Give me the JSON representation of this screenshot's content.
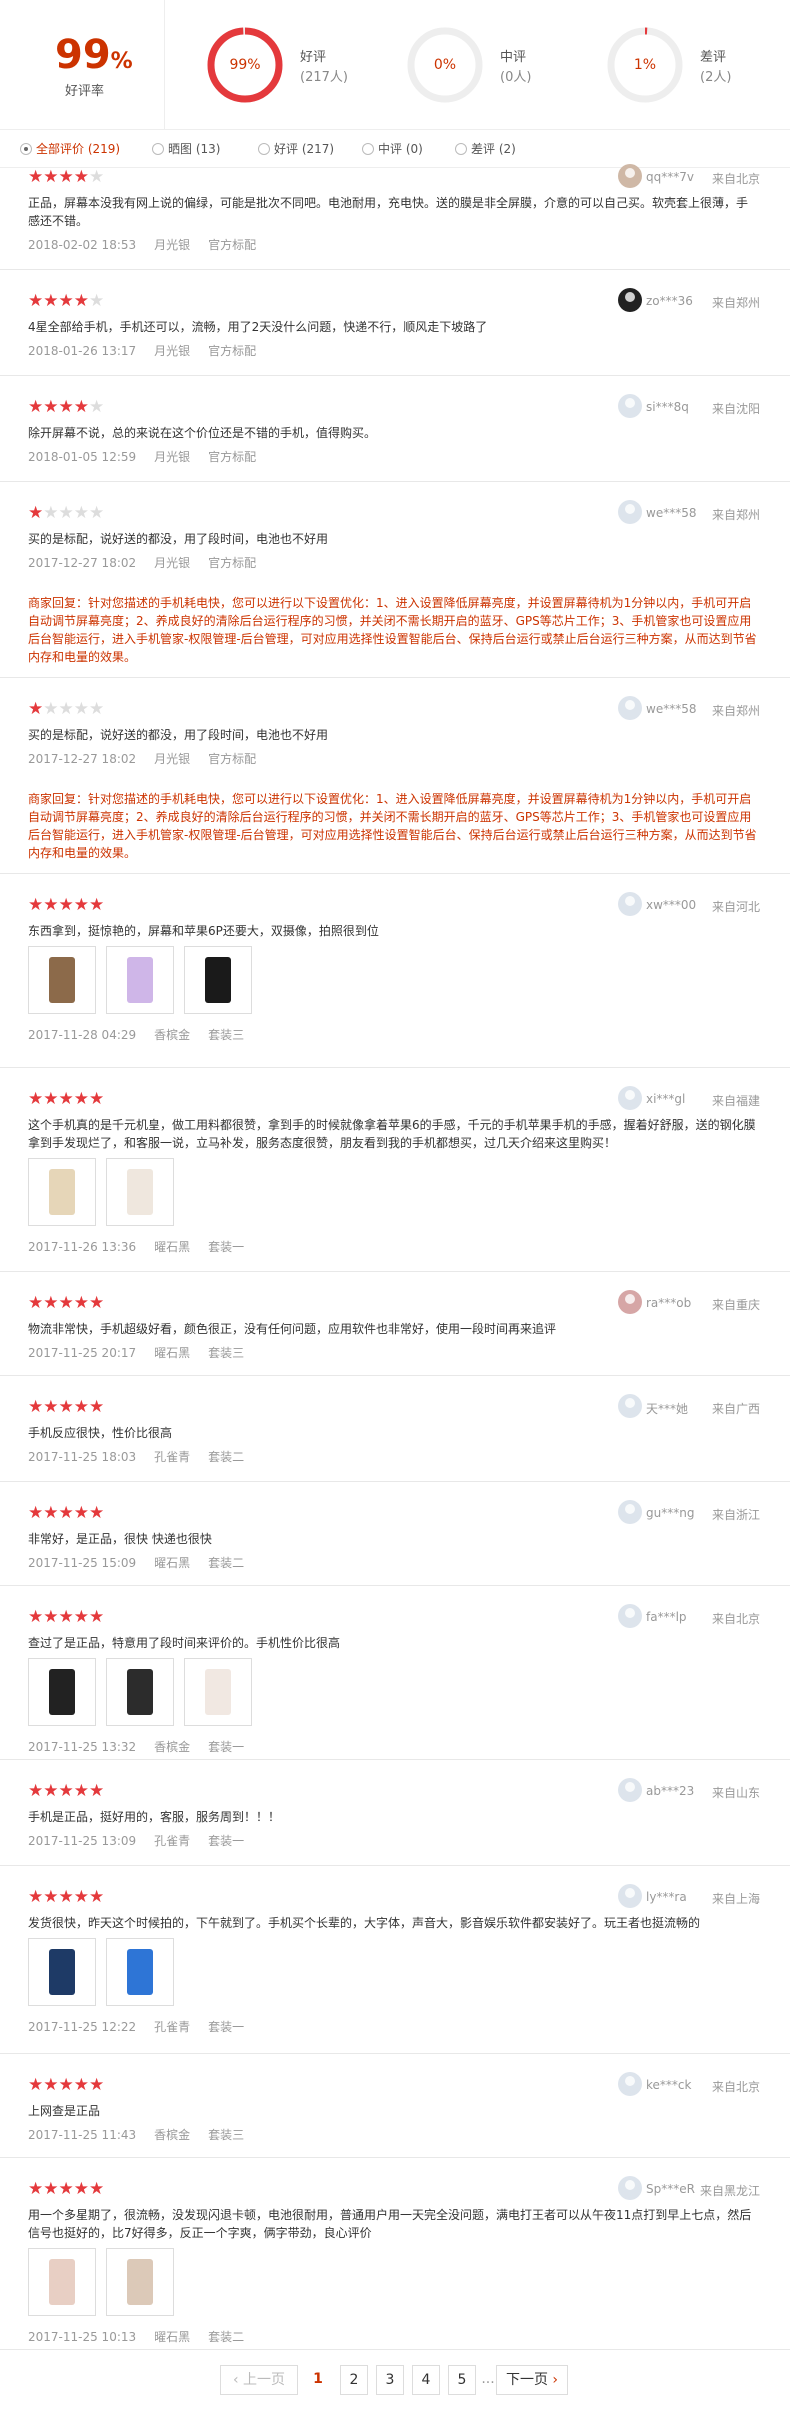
{
  "summary": {
    "rate_value": "99",
    "rate_pct": "%",
    "rate_label": "好评率",
    "good": {
      "pct": "99%",
      "label": "好评",
      "count": "(217人)",
      "fraction": 0.99
    },
    "mid": {
      "pct": "0%",
      "label": "中评",
      "count": "(0人)",
      "fraction": 0.0
    },
    "bad": {
      "pct": "1%",
      "label": "差评",
      "count": "(2人)",
      "fraction": 0.01
    }
  },
  "colors": {
    "accent": "#e4393c",
    "ring_track": "#eeeeee"
  },
  "filters": [
    "全部评价 (219)",
    "晒图 (13)",
    "好评 (217)",
    "中评 (0)",
    "差评 (2)"
  ],
  "reviews": [
    {
      "stars": 4,
      "user": "qq***7v",
      "loc": "来自北京",
      "avatar": "a1",
      "text": "正品，屏幕本没我有网上说的偏绿，可能是批次不同吧。电池耐用，充电快。送的膜是非全屏膜，介意的可以自己买。软壳套上很薄，手感还不错。",
      "date": "2018-02-02 18:53",
      "color": "月光银",
      "pkg": "官方标配"
    },
    {
      "stars": 4,
      "user": "zo***36",
      "loc": "来自郑州",
      "avatar": "a2",
      "text": "4星全部给手机，手机还可以，流畅，用了2天没什么问题，快递不行，顺风走下坡路了",
      "date": "2018-01-26 13:17",
      "color": "月光银",
      "pkg": "官方标配"
    },
    {
      "stars": 4,
      "user": "si***8q",
      "loc": "来自沈阳",
      "avatar": "a0",
      "text": "除开屏幕不说，总的来说在这个价位还是不错的手机，值得购买。",
      "date": "2018-01-05 12:59",
      "color": "月光银",
      "pkg": "官方标配"
    },
    {
      "stars": 1,
      "user": "we***58",
      "loc": "来自郑州",
      "avatar": "a0",
      "text": "买的是标配，说好送的都没，用了段时间，电池也不好用",
      "date": "2017-12-27 18:02",
      "color": "月光银",
      "pkg": "官方标配",
      "reply": "商家回复：针对您描述的手机耗电快，您可以进行以下设置优化：1、进入设置降低屏幕亮度，并设置屏幕待机为1分钟以内，手机可开启自动调节屏幕亮度；2、养成良好的清除后台运行程序的习惯，并关闭不需长期开启的蓝牙、GPS等芯片工作；3、手机管家也可设置应用后台智能运行，进入手机管家-权限管理-后台管理，可对应用选择性设置智能后台、保持后台运行或禁止后台运行三种方案，从而达到节省内存和电量的效果。"
    },
    {
      "stars": 1,
      "user": "we***58",
      "loc": "来自郑州",
      "avatar": "a0",
      "text": "买的是标配，说好送的都没，用了段时间，电池也不好用",
      "date": "2017-12-27 18:02",
      "color": "月光银",
      "pkg": "官方标配",
      "reply": "商家回复：针对您描述的手机耗电快，您可以进行以下设置优化：1、进入设置降低屏幕亮度，并设置屏幕待机为1分钟以内，手机可开启自动调节屏幕亮度；2、养成良好的清除后台运行程序的习惯，并关闭不需长期开启的蓝牙、GPS等芯片工作；3、手机管家也可设置应用后台智能运行，进入手机管家-权限管理-后台管理，可对应用选择性设置智能后台、保持后台运行或禁止后台运行三种方案，从而达到节省内存和电量的效果。"
    },
    {
      "stars": 5,
      "user": "xw***00",
      "loc": "来自河北",
      "avatar": "a0",
      "text": "东西拿到，挺惊艳的，屏幕和苹果6P还要大，双摄像，拍照很到位",
      "date": "2017-11-28 04:29",
      "color": "香槟金",
      "pkg": "套装三",
      "images": 3
    },
    {
      "stars": 5,
      "user": "xi***gl",
      "loc": "来自福建",
      "avatar": "a0",
      "text": "这个手机真的是千元机皇，做工用料都很赞，拿到手的时候就像拿着苹果6的手感，千元的手机苹果手机的手感，握着好舒服，送的钢化膜拿到手发现烂了，和客服一说，立马补发，服务态度很赞，朋友看到我的手机都想买，过几天介绍来这里购买！",
      "date": "2017-11-26 13:36",
      "color": "曜石黑",
      "pkg": "套装一",
      "images": 2
    },
    {
      "stars": 5,
      "user": "ra***ob",
      "loc": "来自重庆",
      "avatar": "a3",
      "text": "物流非常快，手机超级好看，颜色很正，没有任何问题，应用软件也非常好，使用一段时间再来追评",
      "date": "2017-11-25 20:17",
      "color": "曜石黑",
      "pkg": "套装三"
    },
    {
      "stars": 5,
      "user": "天***她",
      "loc": "来自广西",
      "avatar": "a0",
      "text": "手机反应很快，性价比很高",
      "date": "2017-11-25 18:03",
      "color": "孔雀青",
      "pkg": "套装二"
    },
    {
      "stars": 5,
      "user": "gu***ng",
      "loc": "来自浙江",
      "avatar": "a0",
      "text": "非常好，是正品，很快 快递也很快",
      "date": "2017-11-25 15:09",
      "color": "曜石黑",
      "pkg": "套装二"
    },
    {
      "stars": 5,
      "user": "fa***lp",
      "loc": "来自北京",
      "avatar": "a0",
      "text": "查过了是正品，特意用了段时间来评价的。手机性价比很高",
      "date": "2017-11-25 13:32",
      "color": "香槟金",
      "pkg": "套装一",
      "images": 3
    },
    {
      "stars": 5,
      "user": "ab***23",
      "loc": "来自山东",
      "avatar": "a0",
      "text": "手机是正品，挺好用的，客服，服务周到！！！",
      "date": "2017-11-25 13:09",
      "color": "孔雀青",
      "pkg": "套装一"
    },
    {
      "stars": 5,
      "user": "ly***ra",
      "loc": "来自上海",
      "avatar": "a0",
      "text": "发货很快，昨天这个时候拍的，下午就到了。手机买个长辈的，大字体，声音大，影音娱乐软件都安装好了。玩王者也挺流畅的",
      "date": "2017-11-25 12:22",
      "color": "孔雀青",
      "pkg": "套装一",
      "images": 2
    },
    {
      "stars": 5,
      "user": "ke***ck",
      "loc": "来自北京",
      "avatar": "a0",
      "text": "上网查是正品",
      "date": "2017-11-25 11:43",
      "color": "香槟金",
      "pkg": "套装三"
    },
    {
      "stars": 5,
      "user": "Sp***eR",
      "loc": "来自黑龙江",
      "avatar": "a0",
      "text": "用一个多星期了，很流畅，没发现闪退卡顿，电池很耐用，普通用户用一天完全没问题，满电打王者可以从午夜11点打到早上七点，然后信号也挺好的，比7好得多，反正一个字爽，俩字带劲，良心评价",
      "date": "2017-11-25 10:13",
      "color": "曜石黑",
      "pkg": "套装二",
      "images": 2
    }
  ],
  "pager": {
    "prev": "上一页",
    "pages": [
      "1",
      "2",
      "3",
      "4",
      "5"
    ],
    "dots": "...",
    "next": "下一页"
  }
}
